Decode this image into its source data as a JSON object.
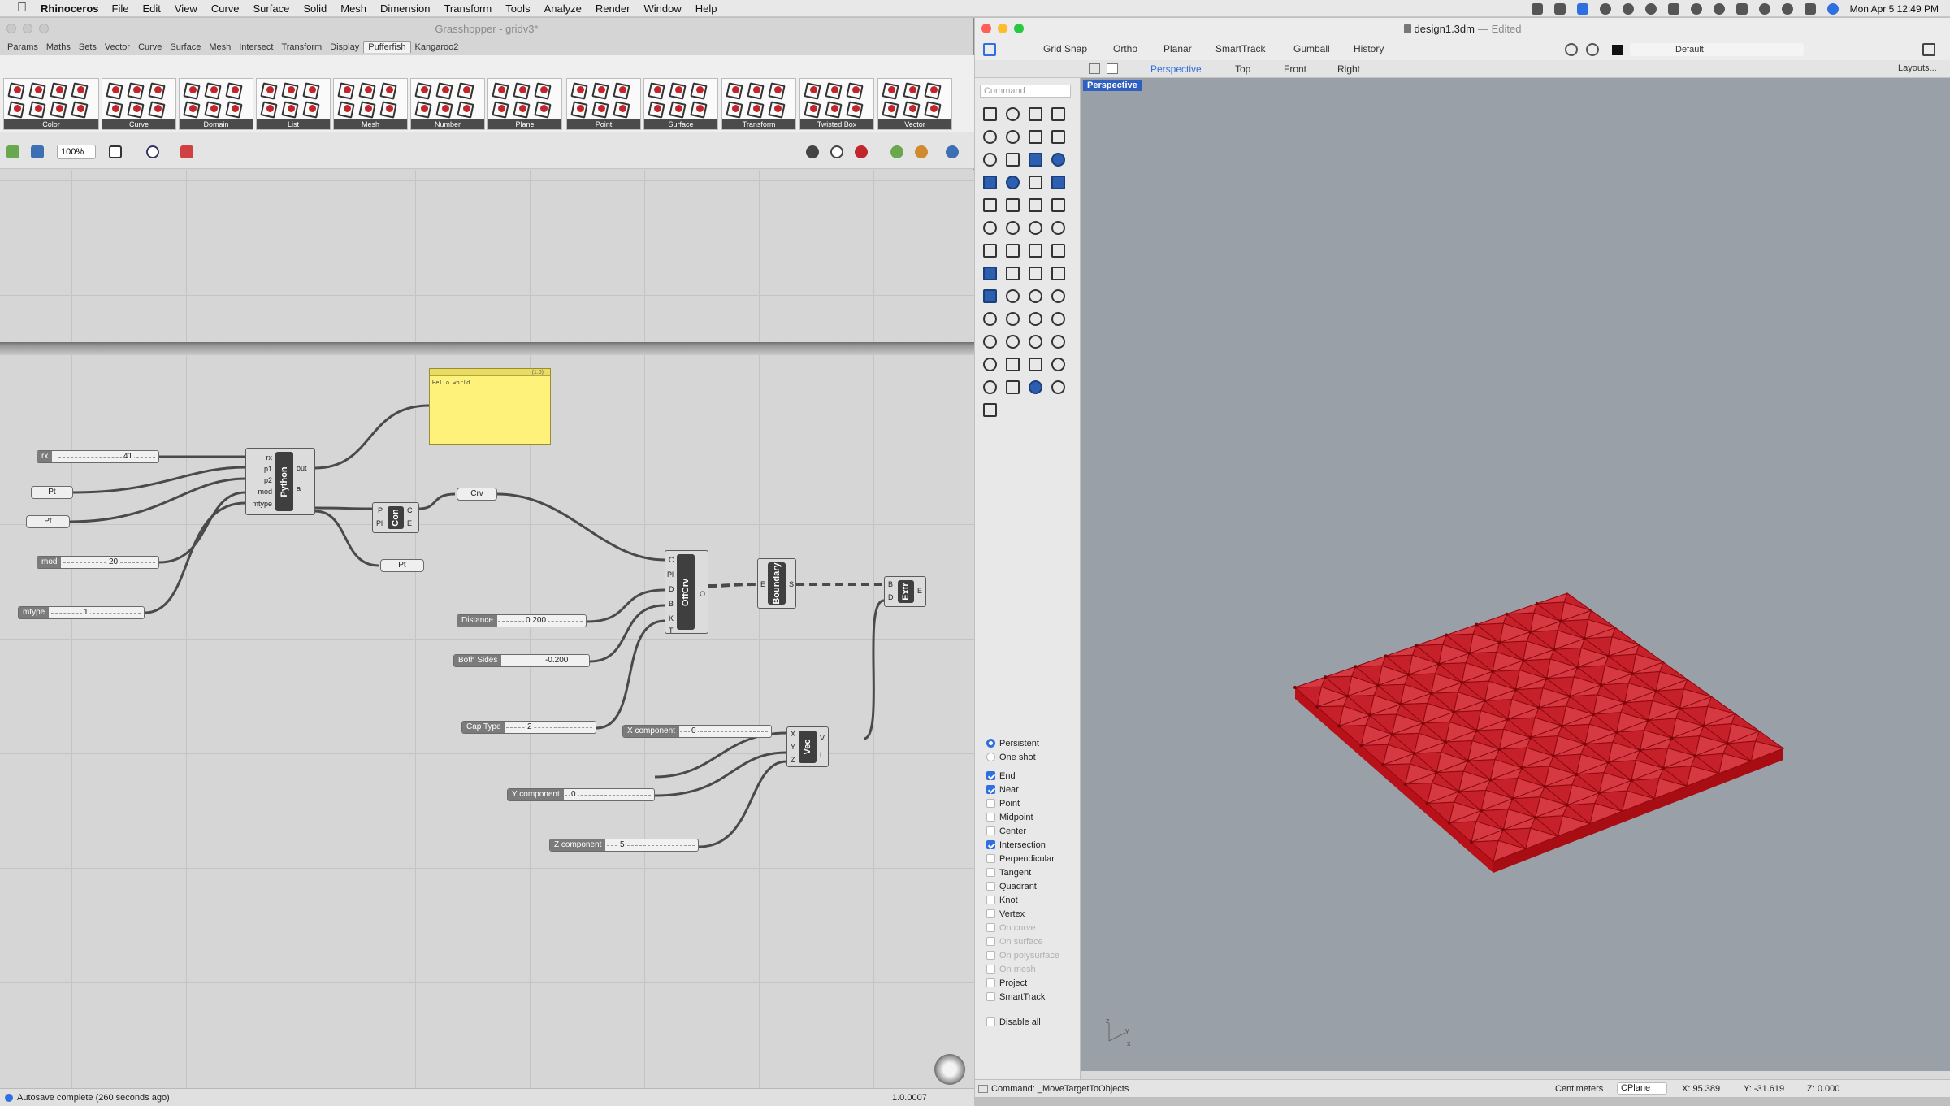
{
  "menubar": {
    "app": "Rhinoceros",
    "items": [
      "File",
      "Edit",
      "View",
      "Curve",
      "Surface",
      "Solid",
      "Mesh",
      "Dimension",
      "Transform",
      "Tools",
      "Analyze",
      "Render",
      "Window",
      "Help"
    ],
    "clock": "Mon Apr 5  12:49 PM"
  },
  "grasshopper": {
    "title": "Grasshopper - gridv3*",
    "tabs": [
      "Params",
      "Maths",
      "Sets",
      "Vector",
      "Curve",
      "Surface",
      "Mesh",
      "Intersect",
      "Transform",
      "Display",
      "Pufferfish",
      "Kangaroo2"
    ],
    "active_tab": "Pufferfish",
    "ribbon_groups": [
      "Color",
      "Curve",
      "Domain",
      "List",
      "Mesh",
      "Number",
      "Plane",
      "Point",
      "Surface",
      "Transform",
      "Twisted Box",
      "Vector"
    ],
    "zoom": "100%",
    "note": {
      "header": "(1:0)",
      "text": "Hello world"
    },
    "sliders": {
      "rx": {
        "label": "rx",
        "value": "41"
      },
      "mod": {
        "label": "mod",
        "value": "20"
      },
      "mtype": {
        "label": "mtype",
        "value": "1"
      },
      "distance": {
        "label": "Distance",
        "value": "0.200"
      },
      "both_sides": {
        "label": "Both Sides",
        "value": "-0.200"
      },
      "cap_type": {
        "label": "Cap Type",
        "value": "2"
      },
      "x_comp": {
        "label": "X component",
        "value": "0"
      },
      "y_comp": {
        "label": "Y component",
        "value": "0"
      },
      "z_comp": {
        "label": "Z component",
        "value": "5"
      }
    },
    "params": {
      "pt1": "Pt",
      "pt2": "Pt",
      "pt3": "Pt",
      "crv": "Crv"
    },
    "components": {
      "python": {
        "title": "Python",
        "inputs": [
          "rx",
          "p1",
          "p2",
          "mod",
          "mtype"
        ],
        "outputs": [
          "out",
          "a"
        ]
      },
      "con": {
        "title": "Con",
        "inputs": [
          "P",
          "Pl"
        ],
        "outputs": [
          "C",
          "E"
        ]
      },
      "offcrv": {
        "title": "OffCrv",
        "inputs": [
          "C",
          "Pl",
          "D",
          "B",
          "K",
          "T"
        ],
        "outputs": [
          "O"
        ]
      },
      "boundary": {
        "title": "Boundary",
        "inputs": [
          "E"
        ],
        "outputs": [
          "S"
        ]
      },
      "extr": {
        "title": "Extr",
        "inputs": [
          "B",
          "D"
        ],
        "outputs": [
          "E"
        ]
      },
      "vec": {
        "title": "Vec",
        "inputs": [
          "X",
          "Y",
          "Z"
        ],
        "outputs": [
          "V",
          "L"
        ]
      }
    },
    "status": "Autosave complete (260 seconds ago)",
    "version": "1.0.0007"
  },
  "rhino": {
    "title": "design1.3dm",
    "edited": "— Edited",
    "toolbar": [
      "Grid Snap",
      "Ortho",
      "Planar",
      "SmartTrack",
      "Gumball",
      "History"
    ],
    "layer": "Default",
    "view_tabs": [
      "Perspective",
      "Top",
      "Front",
      "Right"
    ],
    "layouts": "Layouts...",
    "command_placeholder": "Command",
    "viewport_name": "Perspective",
    "osnap_mode": [
      {
        "label": "Persistent",
        "on": true
      },
      {
        "label": "One shot",
        "on": false
      }
    ],
    "osnaps": [
      {
        "label": "End",
        "on": true,
        "dis": false
      },
      {
        "label": "Near",
        "on": true,
        "dis": false
      },
      {
        "label": "Point",
        "on": false,
        "dis": false
      },
      {
        "label": "Midpoint",
        "on": false,
        "dis": false
      },
      {
        "label": "Center",
        "on": false,
        "dis": false
      },
      {
        "label": "Intersection",
        "on": true,
        "dis": false
      },
      {
        "label": "Perpendicular",
        "on": false,
        "dis": false
      },
      {
        "label": "Tangent",
        "on": false,
        "dis": false
      },
      {
        "label": "Quadrant",
        "on": false,
        "dis": false
      },
      {
        "label": "Knot",
        "on": false,
        "dis": false
      },
      {
        "label": "Vertex",
        "on": false,
        "dis": false
      },
      {
        "label": "On curve",
        "on": false,
        "dis": true
      },
      {
        "label": "On surface",
        "on": false,
        "dis": true
      },
      {
        "label": "On polysurface",
        "on": false,
        "dis": true
      },
      {
        "label": "On mesh",
        "on": false,
        "dis": true
      },
      {
        "label": "Project",
        "on": false,
        "dis": false
      },
      {
        "label": "SmartTrack",
        "on": false,
        "dis": false
      }
    ],
    "disable_all": "Disable all",
    "status": {
      "command": "Command: _MoveTargetToObjects",
      "units": "Centimeters",
      "cplane": "CPlane",
      "x": "X: 95.389",
      "y": "Y: -31.619",
      "z": "Z: 0.000"
    },
    "colors": {
      "mesh_red": "#d8141c",
      "viewport_bg": "#9aa0a8",
      "accent": "#2f6fe0"
    }
  }
}
